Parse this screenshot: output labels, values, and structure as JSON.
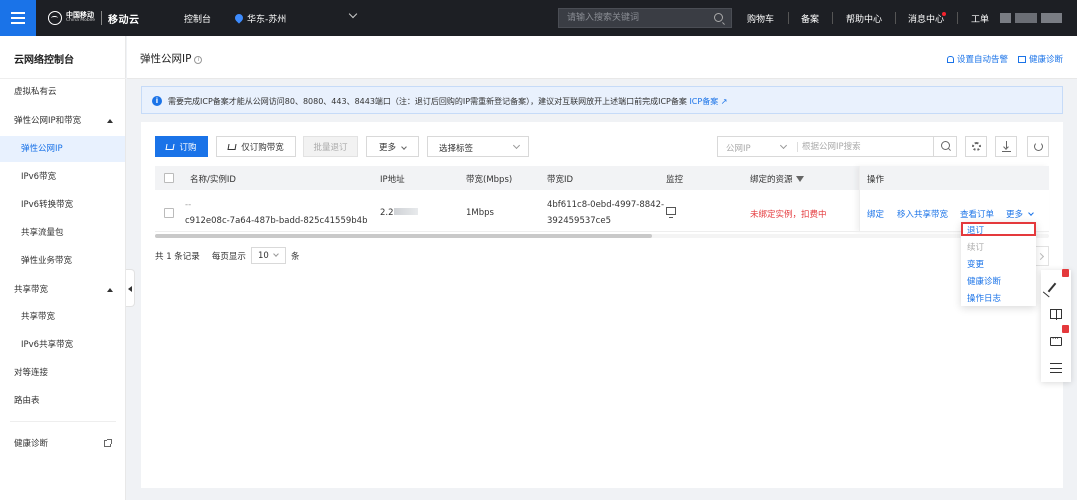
{
  "topbar": {
    "logo_cn": "中国移动",
    "logo_en": "China Mobile",
    "brand": "移动云",
    "console": "控制台",
    "region": "华东-苏州",
    "search_placeholder": "请输入搜索关键词",
    "cart": "购物车",
    "filing": "备案",
    "help": "帮助中心",
    "messages": "消息中心",
    "ticket": "工单",
    "accent": "#1a73e8"
  },
  "sidebar": {
    "title": "云网络控制台",
    "items": [
      {
        "label": "虚拟私有云"
      },
      {
        "label": "弹性公网IP和带宽"
      },
      {
        "label": "弹性公网IP"
      },
      {
        "label": "IPv6带宽"
      },
      {
        "label": "IPv6转换带宽"
      },
      {
        "label": "共享流量包"
      },
      {
        "label": "弹性业务带宽"
      },
      {
        "label": "共享带宽"
      },
      {
        "label": "共享带宽"
      },
      {
        "label": "IPv6共享带宽"
      },
      {
        "label": "对等连接"
      },
      {
        "label": "路由表"
      },
      {
        "label": "健康诊断"
      }
    ]
  },
  "header": {
    "title": "弹性公网IP",
    "alarm_link": "设置自动告警",
    "diagnose_link": "健康诊断"
  },
  "notice": {
    "text": "需要完成ICP备案才能从公网访问80、8080、443、8443端口（注：退订后回购的IP需重新登记备案），建议对互联网放开上述端口前完成ICP备案",
    "link": "ICP备案"
  },
  "toolbar": {
    "order": "订购",
    "order_bandwidth": "仅订购带宽",
    "batch_unsubscribe": "批量退订",
    "more": "更多",
    "tag_select": "选择标签",
    "search_type": "公网IP",
    "search_placeholder": "根据公网IP搜索"
  },
  "table": {
    "columns": [
      "名称/实例ID",
      "IP地址",
      "带宽(Mbps)",
      "带宽ID",
      "监控",
      "绑定的资源",
      "操作"
    ],
    "rows": [
      {
        "name": "--",
        "instance_id": "c912e08c-7a64-487b-badd-825c41559b4b",
        "ip": "2.2",
        "bandwidth": "1Mbps",
        "bandwidth_id_1": "4bf611c8-0ebd-4997-8842-",
        "bandwidth_id_2": "392459537ce5",
        "bound_resource": "未绑定实例，扣费中",
        "actions": [
          "绑定",
          "移入共享带宽",
          "查看订单",
          "更多"
        ]
      }
    ]
  },
  "pagination": {
    "total_text": "共 1 条记录",
    "per_page_label": "每页显示",
    "per_page_value": "10",
    "per_page_unit": "条"
  },
  "more_menu": {
    "items": [
      "退订",
      "续订",
      "变更",
      "健康诊断",
      "操作日志"
    ]
  },
  "tools": {
    "items": [
      "edit-icon",
      "book-icon",
      "message-icon",
      "list-icon"
    ]
  }
}
